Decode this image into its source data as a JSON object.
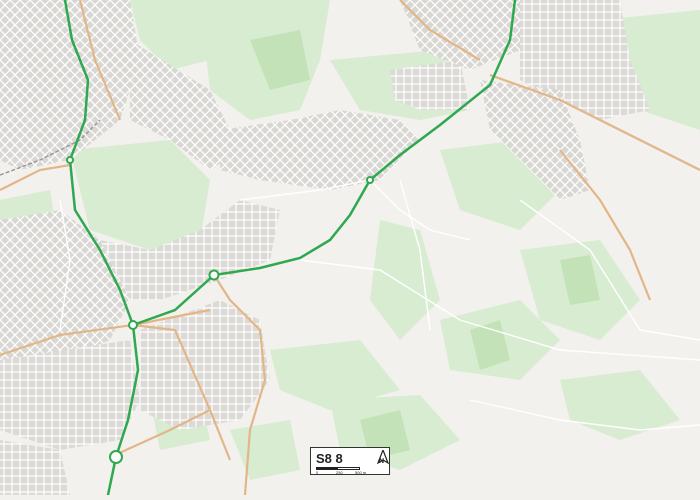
{
  "map": {
    "colors": {
      "background": "#f2f1ed",
      "green_space": "#cfe6c4",
      "light_green": "#dcefd3",
      "main_road": "#2fa84f",
      "secondary_road": "#e3b88a",
      "minor_road": "#ffffff",
      "built_up": "#d8d6d2",
      "railway": "#8a8a8a"
    },
    "legend": {
      "title": "S8 8",
      "north_label": "N",
      "scale_ticks": [
        "0",
        "250",
        "500 m"
      ]
    }
  }
}
